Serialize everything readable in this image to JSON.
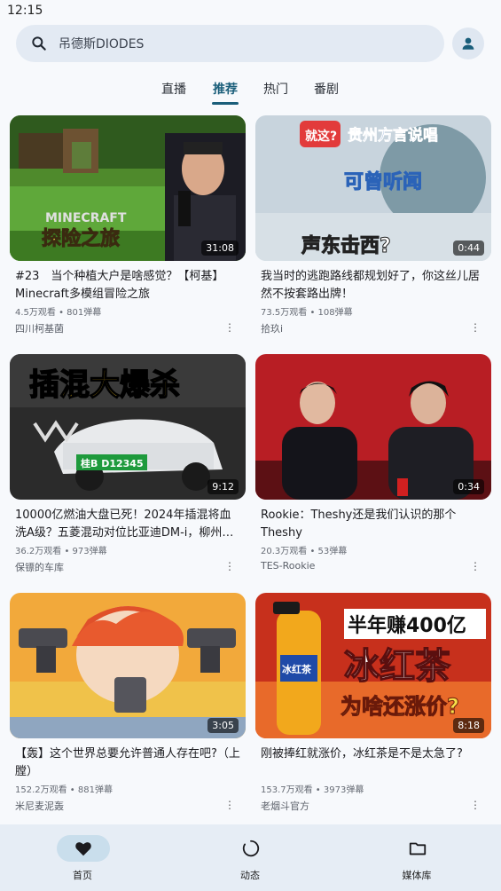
{
  "status": {
    "time": "12:15"
  },
  "search": {
    "placeholder": "吊德斯DIODES"
  },
  "tabs": [
    {
      "label": "直播"
    },
    {
      "label": "推荐"
    },
    {
      "label": "热门"
    },
    {
      "label": "番剧"
    }
  ],
  "videos": [
    {
      "title": "#23　当个种植大户是啥感觉？【柯基】Minecraft多模组冒险之旅",
      "stats": "4.5万观看 • 801弹幕",
      "author": "四川柯基菌",
      "duration": "31:08",
      "thumb_text": [
        "MINECRAFT",
        "探险之旅"
      ]
    },
    {
      "title": "我当时的逃跑路线都规划好了，你这丝儿居然不按套路出牌！",
      "stats": "73.5万观看 • 108弹幕",
      "author": "拾玖i",
      "duration": "0:44",
      "thumb_text": [
        "就这?",
        "贵州方言说唱",
        "可曾听闻",
        "声东击西?"
      ]
    },
    {
      "title": "10000亿燃油大盘已死！2024年插混将血洗A级？五菱混动对位比亚迪DM-i，柳州…",
      "stats": "36.2万观看 • 973弹幕",
      "author": "保镖的车库",
      "duration": "9:12",
      "thumb_text": [
        "插混大爆杀",
        "桂B D12345"
      ]
    },
    {
      "title": "Rookie：Theshy还是我们认识的那个Theshy",
      "stats": "20.3万观看 • 53弹幕",
      "author": "TES-Rookie",
      "duration": "0:34",
      "thumb_text": []
    },
    {
      "title": "【轰】这个世界总要允许普通人存在吧?（上膛）",
      "stats": "152.2万观看 • 881弹幕",
      "author": "米尼麦泥轰",
      "duration": "3:05",
      "thumb_text": []
    },
    {
      "title": "刚被捧红就涨价，冰红茶是不是太急了?",
      "stats": "153.7万观看 • 3973弹幕",
      "author": "老烟斗官方",
      "duration": "8:18",
      "thumb_text": [
        "半年赚400亿",
        "冰红茶",
        "为啥还涨价?",
        "冰红茶"
      ]
    }
  ],
  "bottom_nav": [
    {
      "label": "首页",
      "icon": "heart-icon",
      "active": true
    },
    {
      "label": "动态",
      "icon": "circle-icon",
      "active": false
    },
    {
      "label": "媒体库",
      "icon": "folder-icon",
      "active": false
    }
  ],
  "colors": {
    "accent": "#1a5e7a",
    "background": "#f7f9fc",
    "nav_bg": "#e6edf5"
  }
}
